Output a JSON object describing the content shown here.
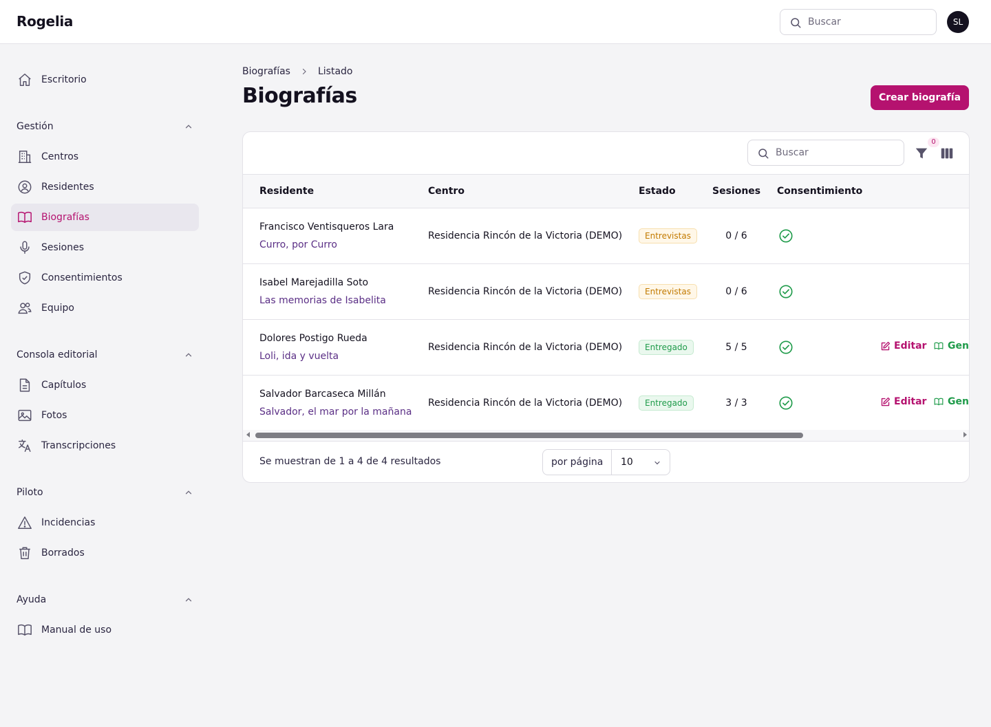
{
  "app": {
    "brand": "Rogelia"
  },
  "topbar": {
    "search_placeholder": "Buscar",
    "avatar_initials": "SL"
  },
  "sidebar": {
    "escritorio": "Escritorio",
    "groups": [
      {
        "label": "Gestión",
        "items": [
          "Centros",
          "Residentes",
          "Biografías",
          "Sesiones",
          "Consentimientos",
          "Equipo"
        ]
      },
      {
        "label": "Consola editorial",
        "items": [
          "Capítulos",
          "Fotos",
          "Transcripciones"
        ]
      },
      {
        "label": "Piloto",
        "items": [
          "Incidencias",
          "Borrados"
        ]
      },
      {
        "label": "Ayuda",
        "items": [
          "Manual de uso"
        ]
      }
    ],
    "active_item": "Biografías"
  },
  "breadcrumb": {
    "root": "Biografías",
    "current": "Listado"
  },
  "page": {
    "title": "Biografías",
    "create_label": "Crear biografía"
  },
  "table": {
    "search_placeholder": "Buscar",
    "filter_count": "0",
    "headers": {
      "residente": "Residente",
      "centro": "Centro",
      "estado": "Estado",
      "sesiones": "Sesiones",
      "consentimiento": "Consentimiento"
    },
    "rows": [
      {
        "name": "Francisco Ventisqueros Lara",
        "title": "Curro, por Curro",
        "centro": "Residencia Rincón de la Victoria (DEMO)",
        "estado": "Entrevistas",
        "sesiones": "0 / 6",
        "consent": true
      },
      {
        "name": "Isabel Marejadilla Soto",
        "title": "Las memorias de Isabelita",
        "centro": "Residencia Rincón de la Victoria (DEMO)",
        "estado": "Entrevistas",
        "sesiones": "0 / 6",
        "consent": true
      },
      {
        "name": "Dolores Postigo Rueda",
        "title": "Loli, ida y vuelta",
        "centro": "Residencia Rincón de la Victoria (DEMO)",
        "estado": "Entregado",
        "sesiones": "5 / 5",
        "consent": true,
        "edit_label": "Editar",
        "gen_label": "Gen"
      },
      {
        "name": "Salvador Barcaseca Millán",
        "title": "Salvador, el mar por la mañana",
        "centro": "Residencia Rincón de la Victoria (DEMO)",
        "estado": "Entregado",
        "sesiones": "3 / 3",
        "consent": true,
        "edit_label": "Editar",
        "gen_label": "Gen"
      }
    ],
    "summary": "Se muestran de 1 a 4 de 4 resultados",
    "per_page_label": "por página",
    "per_page_value": "10"
  },
  "colors": {
    "accent": "#b5126f",
    "success": "#1f9b4a",
    "warning": "#c27a00",
    "link_subtitle": "#5a2e85"
  }
}
